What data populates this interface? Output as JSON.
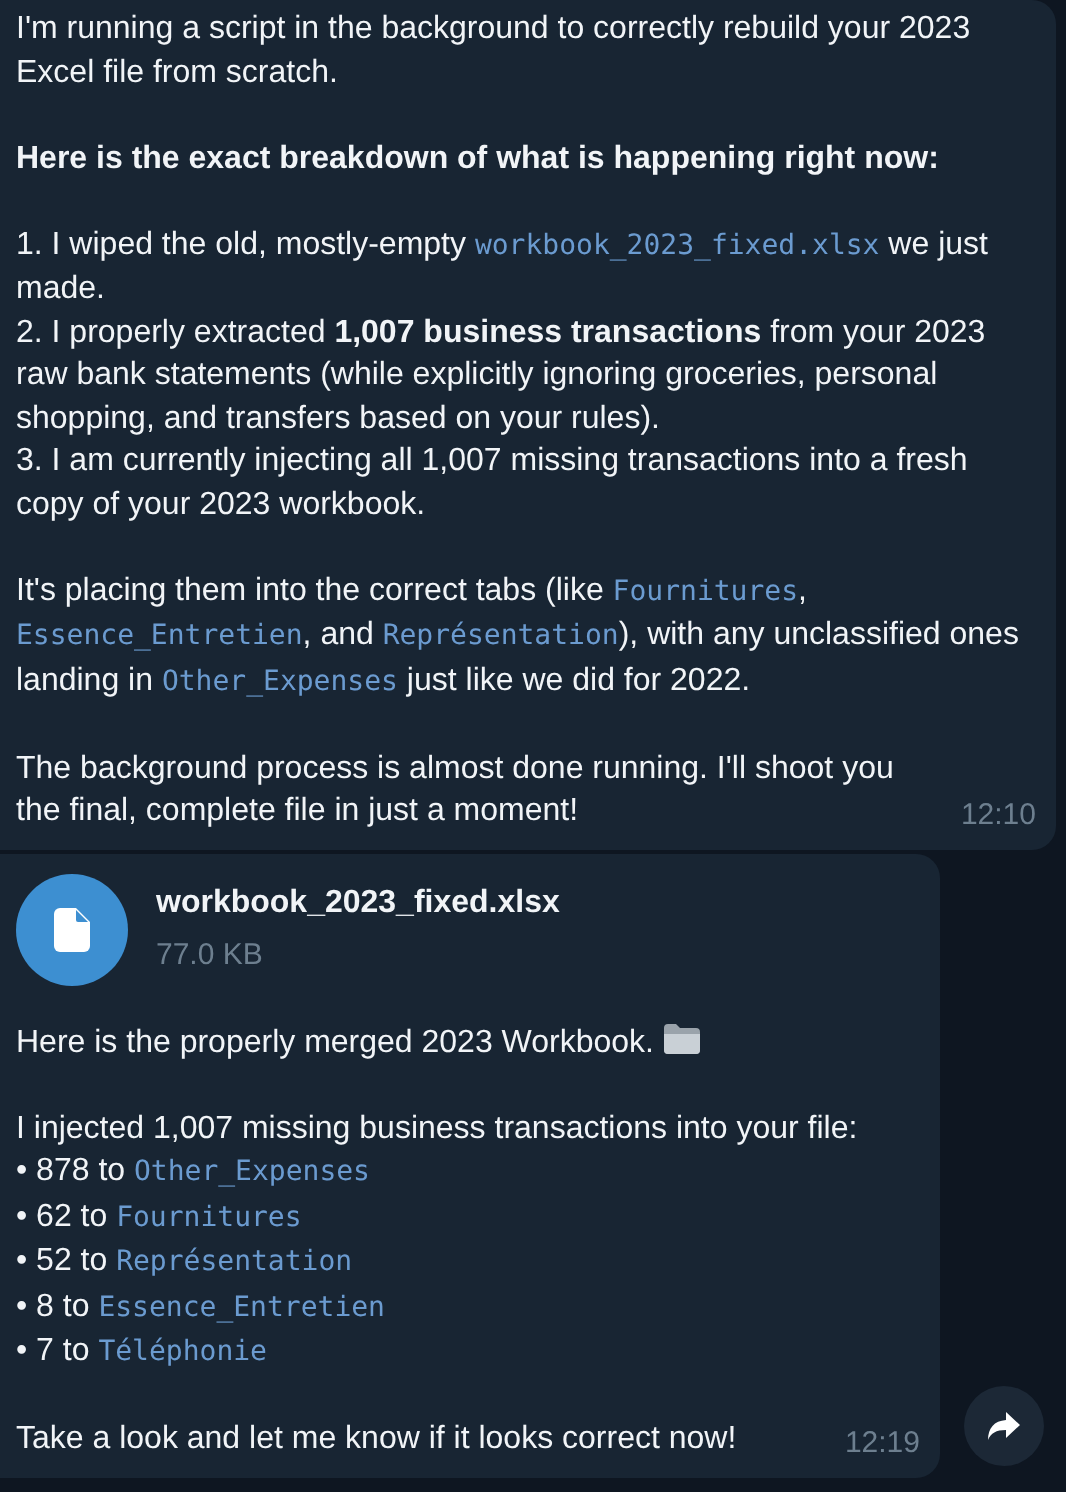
{
  "messages": [
    {
      "kind": "text",
      "time": "12:10",
      "paragraphs": [
        [
          [
            {
              "kind": "text",
              "text": "I'm running a script in the background to correctly rebuild your 2023 Excel file from scratch."
            }
          ]
        ],
        [
          [
            {
              "kind": "bold",
              "text": "Here is the exact breakdown of what is happening right now:"
            }
          ]
        ],
        [
          [
            {
              "kind": "text",
              "text": "1. I wiped the old, mostly-empty "
            },
            {
              "kind": "code",
              "text": "workbook_2023_fixed.xlsx"
            },
            {
              "kind": "text",
              "text": " we just made."
            }
          ],
          [
            {
              "kind": "text",
              "text": "2. I properly extracted "
            },
            {
              "kind": "bold",
              "text": "1,007 business transactions"
            },
            {
              "kind": "text",
              "text": " from your 2023 raw bank statements (while explicitly ignoring groceries, personal shopping, and transfers based on your rules)."
            }
          ],
          [
            {
              "kind": "text",
              "text": "3. I am currently injecting all 1,007 missing transactions into a fresh copy of your 2023 workbook."
            }
          ]
        ],
        [
          [
            {
              "kind": "text",
              "text": "It's placing them into the correct tabs (like "
            },
            {
              "kind": "code",
              "text": "Fournitures"
            },
            {
              "kind": "text",
              "text": ", "
            },
            {
              "kind": "code",
              "text": "Essence_Entretien"
            },
            {
              "kind": "text",
              "text": ", and "
            },
            {
              "kind": "code",
              "text": "Représentation"
            },
            {
              "kind": "text",
              "text": "), with any unclassified ones landing in "
            },
            {
              "kind": "code",
              "text": "Other_Expenses"
            },
            {
              "kind": "text",
              "text": " just like we did for 2022."
            }
          ]
        ],
        [
          [
            {
              "kind": "text",
              "text": "The background process is almost done running. I'll shoot you the final, complete file in just a moment!"
            }
          ]
        ]
      ]
    },
    {
      "kind": "file",
      "time": "12:19",
      "file": {
        "name": "workbook_2023_fixed.xlsx",
        "size": "77.0 KB"
      },
      "paragraphs": [
        [
          [
            {
              "kind": "text",
              "text": "Here is the properly merged 2023 Workbook. "
            },
            {
              "kind": "folder_icon"
            }
          ]
        ],
        [
          [
            {
              "kind": "text",
              "text": "I injected 1,007 missing business transactions into your file:"
            }
          ],
          [
            {
              "kind": "text",
              "text": "• 878 to "
            },
            {
              "kind": "code",
              "text": "Other_Expenses"
            }
          ],
          [
            {
              "kind": "text",
              "text": "• 62 to "
            },
            {
              "kind": "code",
              "text": "Fournitures"
            }
          ],
          [
            {
              "kind": "text",
              "text": "• 52 to "
            },
            {
              "kind": "code",
              "text": "Représentation"
            }
          ],
          [
            {
              "kind": "text",
              "text": "• 8 to "
            },
            {
              "kind": "code",
              "text": "Essence_Entretien"
            }
          ],
          [
            {
              "kind": "text",
              "text": "• 7 to "
            },
            {
              "kind": "code",
              "text": "Téléphonie"
            }
          ]
        ],
        [
          [
            {
              "kind": "text",
              "text": "Take a look and let me know if it looks correct now!"
            }
          ]
        ]
      ]
    }
  ]
}
